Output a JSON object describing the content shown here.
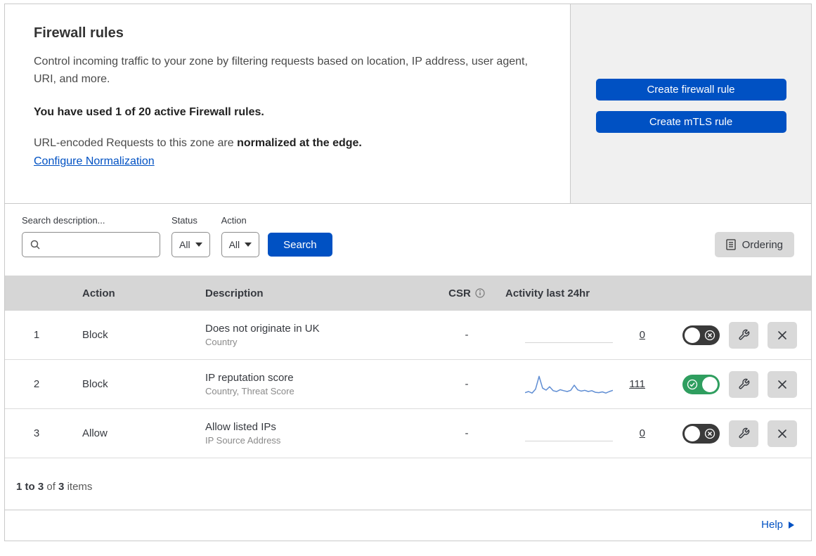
{
  "header": {
    "title": "Firewall rules",
    "description": "Control incoming traffic to your zone by filtering requests based on location, IP address, user agent, URI, and more.",
    "usage_note": "You have used 1 of 20 active Firewall rules.",
    "normalization_prefix": "URL-encoded Requests to this zone are",
    "normalization_bold": "normalized at the edge.",
    "normalization_link": "Configure Normalization",
    "create_firewall_button": "Create firewall rule",
    "create_mtls_button": "Create mTLS rule"
  },
  "filters": {
    "search_label": "Search description...",
    "status_label": "Status",
    "status_value": "All",
    "action_label": "Action",
    "action_value": "All",
    "search_button": "Search",
    "ordering_button": "Ordering"
  },
  "table": {
    "headers": {
      "action": "Action",
      "description": "Description",
      "csr": "CSR",
      "activity": "Activity last 24hr"
    },
    "rows": [
      {
        "priority": "1",
        "action": "Block",
        "description": "Does not originate in UK",
        "criteria": "Country",
        "csr": "-",
        "activity_count": "0",
        "enabled": false,
        "sparkline": []
      },
      {
        "priority": "2",
        "action": "Block",
        "description": "IP reputation score",
        "criteria": "Country, Threat Score",
        "csr": "-",
        "activity_count": "111",
        "enabled": true,
        "sparkline": [
          12,
          18,
          10,
          30,
          95,
          35,
          25,
          42,
          22,
          18,
          27,
          22,
          18,
          24,
          50,
          26,
          20,
          24,
          18,
          22,
          14,
          12,
          16,
          10,
          18,
          24
        ]
      },
      {
        "priority": "3",
        "action": "Allow",
        "description": "Allow listed IPs",
        "criteria": "IP Source Address",
        "csr": "-",
        "activity_count": "0",
        "enabled": false,
        "sparkline": []
      }
    ]
  },
  "footer": {
    "range": "1 to 3",
    "of_label": "of",
    "total": "3",
    "items_label": "items",
    "help_link": "Help"
  },
  "colors": {
    "primary_blue": "#0051c3",
    "toggle_on_green": "#2f9e5f",
    "toggle_off_dark": "#3a3a3a",
    "sparkline_blue": "#5f8dd3",
    "table_header_bg": "#d6d6d6",
    "panel_bg": "#f0f0f0"
  }
}
